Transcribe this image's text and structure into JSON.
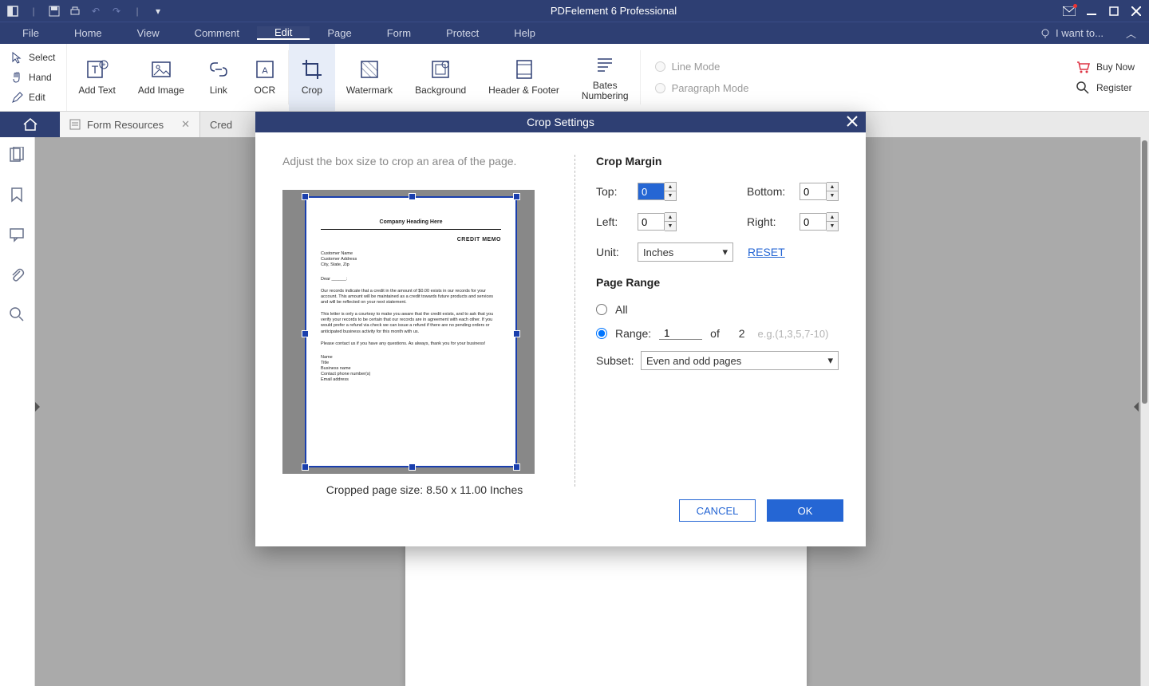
{
  "app": {
    "title": "PDFelement 6 Professional"
  },
  "menubar": {
    "file": "File",
    "home": "Home",
    "view": "View",
    "comment": "Comment",
    "edit": "Edit",
    "page": "Page",
    "form": "Form",
    "protect": "Protect",
    "help": "Help",
    "iwant": "I want to..."
  },
  "ribbon": {
    "select": "Select",
    "hand": "Hand",
    "editbtn": "Edit",
    "addtext": "Add Text",
    "addimage": "Add Image",
    "link": "Link",
    "ocr": "OCR",
    "crop": "Crop",
    "watermark": "Watermark",
    "background": "Background",
    "headerfooter": "Header & Footer",
    "bates": "Bates\nNumbering",
    "linemode": "Line Mode",
    "paramode": "Paragraph Mode",
    "buynow": "Buy Now",
    "register": "Register"
  },
  "tabs": {
    "tab1": "Form Resources",
    "tab2": "Cred"
  },
  "dialog": {
    "title": "Crop Settings",
    "instruction": "Adjust the box size to crop an area of the page.",
    "sizetext": "Cropped page size: 8.50 x 11.00 Inches",
    "cropmargin": "Crop Margin",
    "top": "Top:",
    "bottom": "Bottom:",
    "left": "Left:",
    "right": "Right:",
    "unit": "Unit:",
    "topval": "0",
    "bottomval": "0",
    "leftval": "0",
    "rightval": "0",
    "unitval": "Inches",
    "reset": "RESET",
    "pagerange": "Page Range",
    "all": "All",
    "range": "Range:",
    "rangeval": "1",
    "of": "of",
    "total": "2",
    "hint": "e.g.(1,3,5,7-10)",
    "subset": "Subset:",
    "subsetval": "Even and odd pages",
    "cancel": "CANCEL",
    "ok": "OK"
  },
  "preview": {
    "heading": "Company Heading Here",
    "memo": "CREDIT MEMO"
  }
}
